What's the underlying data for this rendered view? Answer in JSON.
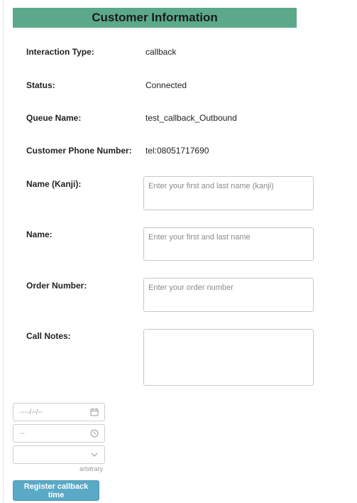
{
  "header": {
    "title": "Customer Information"
  },
  "info": [
    {
      "label": "Interaction Type:",
      "value": "callback"
    },
    {
      "label": "Status:",
      "value": "Connected"
    },
    {
      "label": "Queue Name:",
      "value": "test_callback_Outbound"
    },
    {
      "label": "Customer Phone Number:",
      "value": "tel:08051717690"
    }
  ],
  "form": {
    "name_kanji": {
      "label": "Name (Kanji):",
      "placeholder": "Enter your first and last name (kanji)",
      "value": ""
    },
    "name": {
      "label": "Name:",
      "placeholder": "Enter your first and last name",
      "value": ""
    },
    "order_number": {
      "label": "Order Number:",
      "placeholder": "Enter your order number",
      "value": ""
    },
    "call_notes": {
      "label": "Call Notes:",
      "placeholder": "",
      "value": ""
    }
  },
  "callback": {
    "date_text": "----/--/--",
    "time_text": "--",
    "select_value": "",
    "hint": "arbitrary",
    "submit_label": "Register callback time",
    "icons": {
      "date": "calendar-icon",
      "time": "clock-icon",
      "select": "chevron-down-icon"
    }
  },
  "colors": {
    "header_bg": "#5ba88a",
    "button_bg": "#5aa9c6"
  }
}
